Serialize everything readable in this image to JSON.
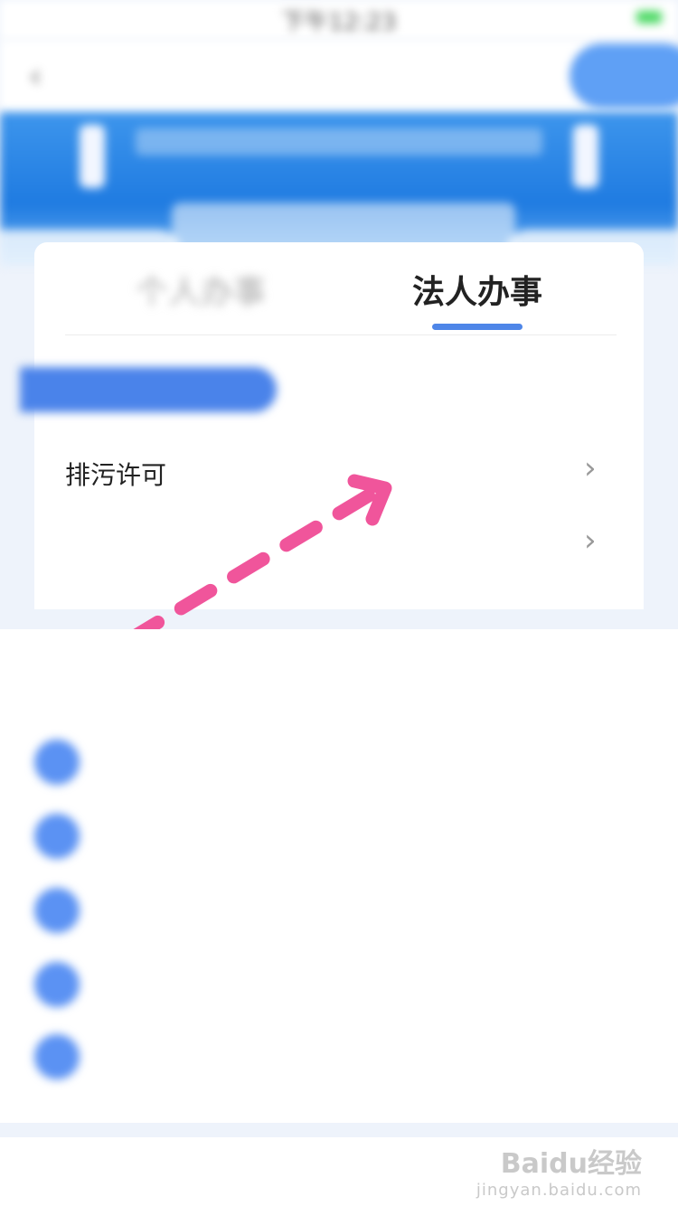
{
  "status_bar": {
    "carrier": "",
    "time": "下午12:23",
    "battery": ""
  },
  "nav": {
    "title": "",
    "action_label": ""
  },
  "tabs": [
    {
      "label": "个人办事",
      "active": false
    },
    {
      "label": "法人办事",
      "active": true
    }
  ],
  "section": {
    "label": ""
  },
  "list_items": [
    {
      "label": "排污许可"
    },
    {
      "label": ""
    }
  ],
  "info": {
    "title": "",
    "rows": [
      {
        "text": ""
      },
      {
        "text": ""
      },
      {
        "text": ""
      },
      {
        "text": ""
      },
      {
        "text": ""
      }
    ]
  },
  "bottom": {
    "text": ""
  },
  "watermark": {
    "logo": "Baidu经验",
    "sub": "jingyan.baidu.com"
  },
  "colors": {
    "accent": "#4e86e8",
    "arrow": "#f0559b",
    "banner": "#2f86e6"
  }
}
